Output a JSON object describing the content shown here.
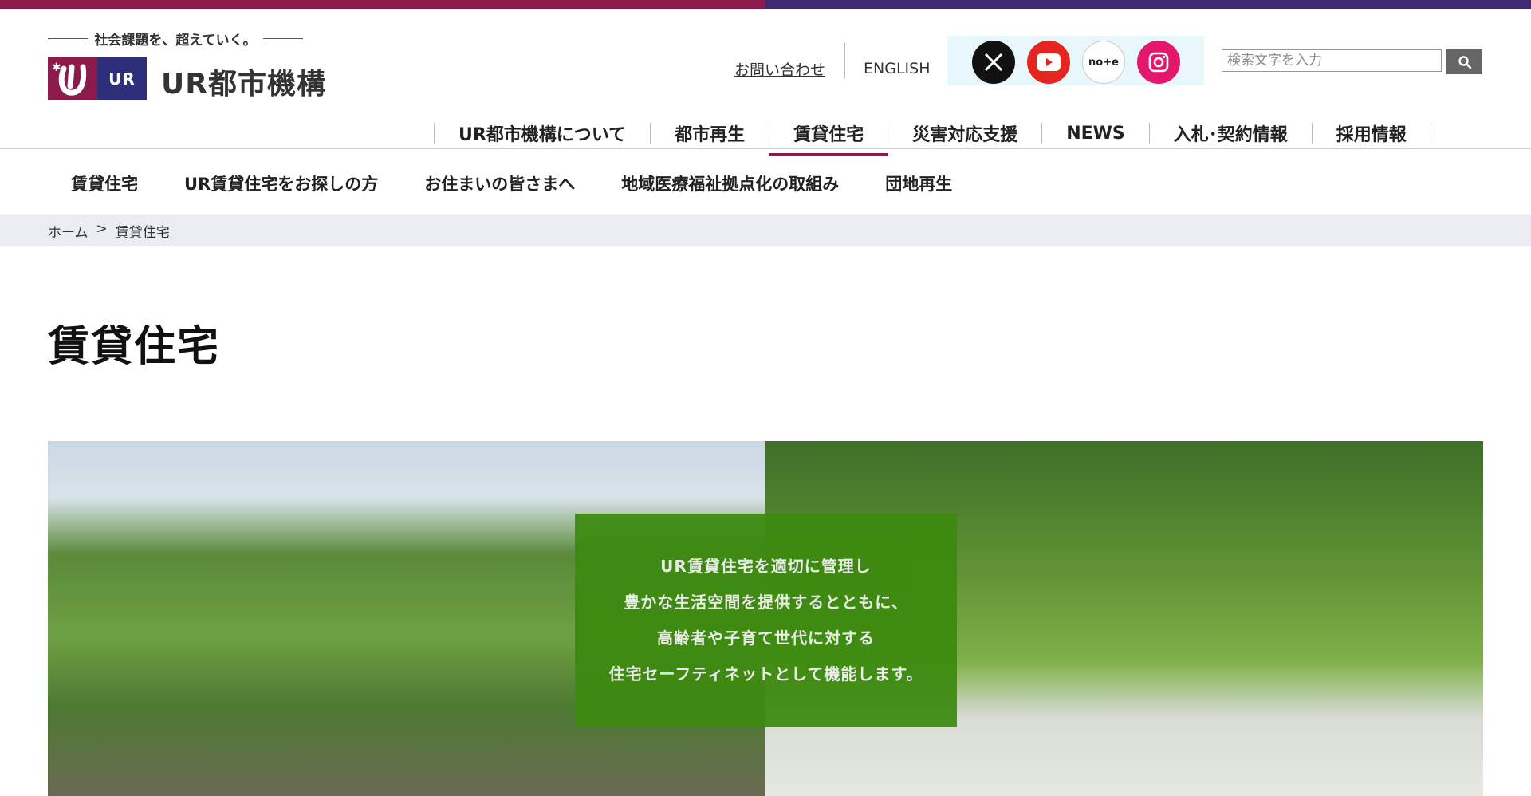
{
  "brand": {
    "tagline": "社会課題を、超えていく。",
    "mark_text": "UR",
    "name": "UR都市機構",
    "colors": {
      "brand_magenta": "#8c1a4b",
      "brand_navy": "#2e2f7a",
      "caption_green": "#3c8a0f"
    }
  },
  "utility": {
    "contact": "お問い合わせ",
    "english": "ENGLISH",
    "sns": [
      {
        "name": "x",
        "icon": "x-icon"
      },
      {
        "name": "youtube",
        "icon": "youtube-icon"
      },
      {
        "name": "note",
        "icon": "note-icon",
        "label": "no+e"
      },
      {
        "name": "instagram",
        "icon": "instagram-icon"
      }
    ],
    "search": {
      "placeholder": "検索文字を入力",
      "button_icon": "search-icon"
    }
  },
  "global_nav": {
    "items": [
      {
        "label": "UR都市機構について"
      },
      {
        "label": "都市再生"
      },
      {
        "label": "賃貸住宅",
        "active": true
      },
      {
        "label": "災害対応支援"
      },
      {
        "label": "NEWS"
      },
      {
        "label": "入札･契約情報"
      },
      {
        "label": "採用情報"
      }
    ]
  },
  "sub_nav": {
    "items": [
      {
        "label": "賃貸住宅"
      },
      {
        "label": "UR賃貸住宅をお探しの方"
      },
      {
        "label": "お住まいの皆さまへ"
      },
      {
        "label": "地域医療福祉拠点化の取組み"
      },
      {
        "label": "団地再生"
      }
    ]
  },
  "breadcrumb": {
    "home": "ホーム",
    "separator": ">",
    "current": "賃貸住宅"
  },
  "page": {
    "title": "賃貸住宅"
  },
  "hero": {
    "caption_lines": [
      "UR賃貸住宅を適切に管理し",
      "豊かな生活空間を提供するとともに、",
      "高齢者や子育て世代に対する",
      "住宅セーフティネットとして機能します。"
    ]
  }
}
